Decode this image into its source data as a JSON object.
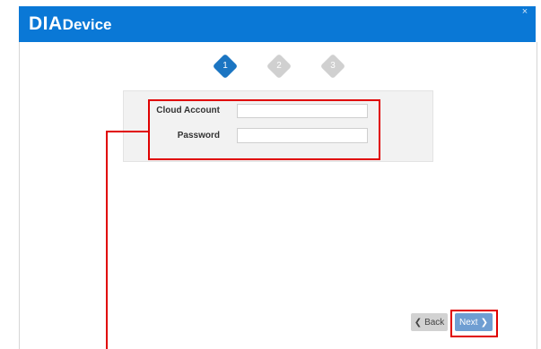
{
  "header": {
    "logo_dia": "DIA",
    "logo_device": "Device",
    "close_symbol": "×"
  },
  "steps": [
    {
      "number": "1",
      "state": "active"
    },
    {
      "number": "2",
      "state": "inactive"
    },
    {
      "number": "3",
      "state": "inactive"
    }
  ],
  "form": {
    "account_label": "Cloud Account",
    "account_value": "",
    "password_label": "Password",
    "password_value": ""
  },
  "buttons": {
    "back_icon": "❮",
    "back_label": "Back",
    "next_label": "Next",
    "next_icon": "❯"
  },
  "colors": {
    "header_bg": "#0a78d6",
    "step_active": "#1b75c2",
    "step_inactive": "#d0d0d0",
    "next_button": "#6f9ed2",
    "annotation": "#e00000"
  }
}
